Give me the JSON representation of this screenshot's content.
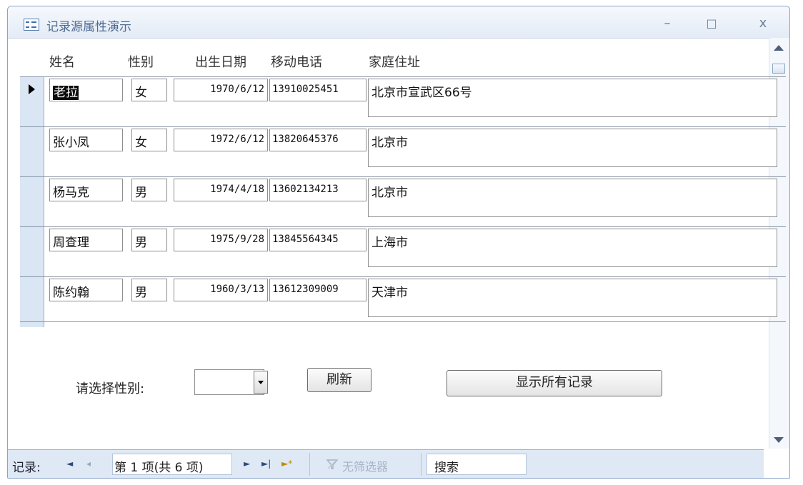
{
  "window": {
    "title": "记录源属性演示",
    "minimize": "–",
    "maximize": "□",
    "close": "x"
  },
  "columns": [
    "姓名",
    "性别",
    "出生日期",
    "移动电话",
    "家庭住址"
  ],
  "records": [
    {
      "name": "老拉",
      "gender": "女",
      "birth": "1970/6/12",
      "phone": "13910025451",
      "address": "北京市宣武区66号"
    },
    {
      "name": "张小凤",
      "gender": "女",
      "birth": "1972/6/12",
      "phone": "13820645376",
      "address": "北京市"
    },
    {
      "name": "杨马克",
      "gender": "男",
      "birth": "1974/4/18",
      "phone": "13602134213",
      "address": "北京市"
    },
    {
      "name": "周查理",
      "gender": "男",
      "birth": "1975/9/28",
      "phone": "13845564345",
      "address": "上海市"
    },
    {
      "name": "陈约翰",
      "gender": "男",
      "birth": "1960/3/13",
      "phone": "13612309009",
      "address": "天津市"
    }
  ],
  "footer": {
    "gender_label": "请选择性别:",
    "gender_value": "",
    "refresh_label": "刷新",
    "show_all_label": "显示所有记录"
  },
  "statusbar": {
    "record_label": "记录:",
    "first": "◄",
    "prev": "◂",
    "position": "第 1 项(共 6 项)",
    "next": "►",
    "last": "►|",
    "new": "►*",
    "filter_icon": "funnel-icon",
    "filter_status": "无筛选器",
    "search": "搜索"
  }
}
